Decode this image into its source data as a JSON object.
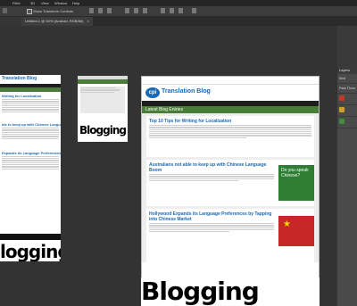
{
  "menubar": {
    "items": [
      "Filter",
      "3D",
      "View",
      "Window",
      "Help"
    ]
  },
  "optionsbar": {
    "show_transform_label": "Show Transform Controls"
  },
  "tabs": [
    {
      "label": "Untitled-1 @ 50% (Android, RGB/8#)"
    }
  ],
  "panel": {
    "title": "Layers",
    "rows": [
      {
        "label": "Kind"
      },
      {
        "label": "Pass Throu"
      },
      {
        "label": ""
      },
      {
        "label": ""
      },
      {
        "label": ""
      }
    ]
  },
  "blog": {
    "site_title": "Translation Blog",
    "section_header": "Latest Blog Entries",
    "posts": [
      {
        "title": "Top 10 Tips for Writing for Localization"
      },
      {
        "title": "Australians not able to keep up with Chinese Language Boom"
      },
      {
        "title": "Hollywood Expands its Language Preferences by Tapping into Chinese Market"
      }
    ],
    "left_titles": [
      "Writing for Localization",
      "ble to keep up with Chinese Language",
      "Expands its Language Preferences by Tap"
    ],
    "sign_text": "Do you speak Chinese?"
  },
  "bigwords": {
    "center": "Blogging",
    "thumb": "Blogging",
    "left": "logging"
  },
  "colors": {
    "blog_blue": "#1a69b5",
    "blog_green": "#4a7c3a",
    "layer_red": "#c0392b",
    "layer_yellow": "#c9a227",
    "layer_green": "#3e8e41"
  }
}
